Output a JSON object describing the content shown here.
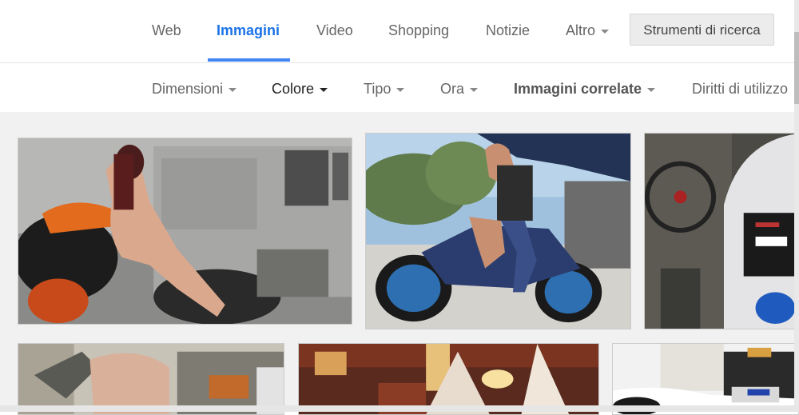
{
  "nav": {
    "tabs": [
      {
        "label": "Web"
      },
      {
        "label": "Immagini",
        "active": true
      },
      {
        "label": "Video"
      },
      {
        "label": "Shopping"
      },
      {
        "label": "Notizie"
      },
      {
        "label": "Altro"
      }
    ],
    "tools_label": "Strumenti di ricerca"
  },
  "filters": [
    {
      "label": "Dimensioni"
    },
    {
      "label": "Colore"
    },
    {
      "label": "Tipo"
    },
    {
      "label": "Ora"
    },
    {
      "label": "Immagini correlate"
    },
    {
      "label": "Diritti di utilizzo"
    }
  ],
  "colors": {
    "active_tab": "#1a73e8",
    "underline": "#4285f4",
    "grid_background": "#f1f1f1"
  }
}
